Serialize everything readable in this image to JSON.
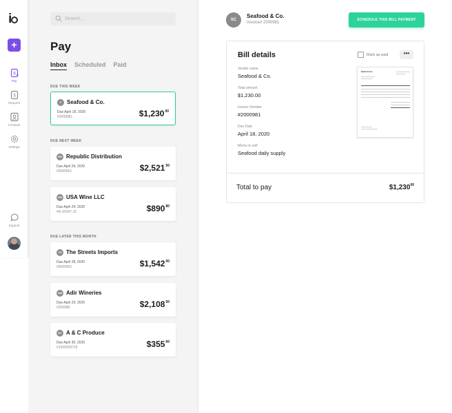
{
  "app": {
    "logo": "io"
  },
  "nav": {
    "add_label": "+",
    "items": [
      {
        "label": "Pay",
        "icon": "pay-icon",
        "active": true
      },
      {
        "label": "Request",
        "icon": "request-icon",
        "active": false
      },
      {
        "label": "Contacts",
        "icon": "contacts-icon",
        "active": false
      },
      {
        "label": "Settings",
        "icon": "settings-icon",
        "active": false
      }
    ],
    "support_label": "Support"
  },
  "search": {
    "placeholder": "Search..."
  },
  "page": {
    "title": "Pay"
  },
  "tabs": [
    {
      "label": "Inbox",
      "active": true
    },
    {
      "label": "Scheduled",
      "active": false
    },
    {
      "label": "Paid",
      "active": false
    }
  ],
  "sections": [
    {
      "label": "DUE THIS WEEK",
      "bills": [
        {
          "initials": "F",
          "vendor": "Seafood & Co.",
          "due": "Due April 18, 2020",
          "invoice": "#2000981",
          "amount_main": "$1,230",
          "amount_cents": "00",
          "selected": true
        }
      ]
    },
    {
      "label": "DUE NEXT WEEK",
      "bills": [
        {
          "initials": "RN",
          "vendor": "Republic Distribution",
          "due": "Due April 24, 2020",
          "invoice": "#2005561",
          "amount_main": "$2,521",
          "amount_cents": "50",
          "selected": false
        },
        {
          "initials": "UW",
          "vendor": "USA Wine LLC",
          "due": "Due April 24, 2020",
          "invoice": "#A-10347-JZ",
          "amount_main": "$890",
          "amount_cents": "80",
          "selected": false
        }
      ]
    },
    {
      "label": "DUE LATER THIS MONTH",
      "bills": [
        {
          "initials": "TS",
          "vendor": "The Streets Imports",
          "due": "Due April 28, 2020",
          "invoice": "#5000991",
          "amount_main": "$1,542",
          "amount_cents": "00",
          "selected": false
        },
        {
          "initials": "AW",
          "vendor": "Adir Wineries",
          "due": "Due April 29, 2020",
          "invoice": "#200586",
          "amount_main": "$2,108",
          "amount_cents": "50",
          "selected": false
        },
        {
          "initials": "AC",
          "vendor": "A & C Produce",
          "due": "Due April 30, 2020",
          "invoice": "#1000028719",
          "amount_main": "$355",
          "amount_cents": "60",
          "selected": false
        }
      ]
    }
  ],
  "detail": {
    "initials": "SC",
    "vendor": "Seafood & Co.",
    "invoice_line": "Invoice# 2000981",
    "schedule_button": "SCHEDULE THIS BILL PAYMENT",
    "bill_details_title": "Bill details",
    "mark_as_paid": "Mark as paid",
    "more_label": "•••",
    "fields": [
      {
        "label": "Vendor name",
        "value": "Seafood & Co."
      },
      {
        "label": "Total amount",
        "value": "$1,230.00"
      },
      {
        "label": "Invoice Number",
        "value": "#2000981"
      },
      {
        "label": "Due Date",
        "value": "April 18, 2020"
      },
      {
        "label": "Memo to self",
        "value": "Seafood daily supply"
      }
    ],
    "thumbnail_title": "Seafood & Co.",
    "total_label": "Total to pay",
    "total_main": "$1,230",
    "total_cents": "00"
  },
  "colors": {
    "accent": "#7b4fe6",
    "success": "#2ed39a",
    "selected_border": "#2ec79a"
  }
}
